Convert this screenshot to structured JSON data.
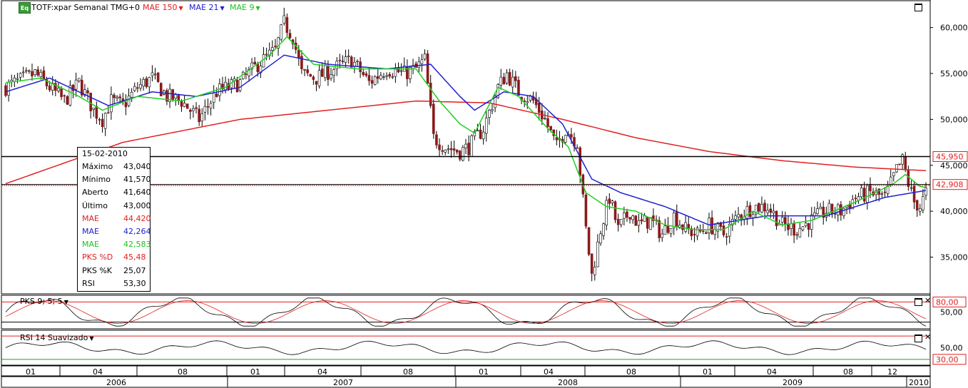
{
  "header": {
    "logo_text": "Eq",
    "title": "TOTF:xpar Semanal TMG+0",
    "indicators": [
      {
        "label": "MAE 150",
        "color": "#e02020"
      },
      {
        "label": "MAE 21",
        "color": "#2020d0"
      },
      {
        "label": "MAE 9",
        "color": "#20d020"
      }
    ]
  },
  "info_box": {
    "date": "15-02-2010",
    "rows": [
      {
        "label": "Máximo",
        "value": "43,040",
        "color": "#000000"
      },
      {
        "label": "Mínimo",
        "value": "41,570",
        "color": "#000000"
      },
      {
        "label": "Aberto",
        "value": "41,640",
        "color": "#000000"
      },
      {
        "label": "Último",
        "value": "43,000",
        "color": "#000000"
      },
      {
        "label": "MAE",
        "value": "44,420",
        "color": "#e02020"
      },
      {
        "label": "MAE",
        "value": "42,264",
        "color": "#2020d0"
      },
      {
        "label": "MAE",
        "value": "42,583",
        "color": "#20c020"
      },
      {
        "label": "PKS %D",
        "value": "45,48",
        "color": "#e02020"
      },
      {
        "label": "PKS %K",
        "value": "25,07",
        "color": "#000000"
      },
      {
        "label": "RSI",
        "value": "53,30",
        "color": "#000000"
      }
    ]
  },
  "panes": {
    "pks_label": "PKS 9; 5; 5",
    "rsi_label": "RSI 14 Suavizado"
  },
  "chart_data": [
    {
      "type": "candlestick",
      "ylim": [
        31000,
        63000
      ],
      "y_ticks": [
        "60,000",
        "55,000",
        "50,000",
        "45,000",
        "40,000",
        "35,000"
      ],
      "y_tick_values": [
        60000,
        55000,
        50000,
        45000,
        40000,
        35000
      ],
      "horizontal_lines": [
        {
          "value": 45950,
          "label": "45,950"
        },
        {
          "value": 42908,
          "label": "42,908"
        }
      ],
      "x_ticks": [
        "01",
        "04",
        "08",
        "01",
        "04",
        "08",
        "01",
        "04",
        "08",
        "01",
        "04",
        "08",
        "12"
      ],
      "x_years": [
        "2006",
        "2007",
        "2008",
        "2009",
        "2010"
      ],
      "price_path": [
        [
          0,
          53500
        ],
        [
          10,
          55000
        ],
        [
          20,
          52000
        ],
        [
          25,
          54000
        ],
        [
          30,
          51000
        ],
        [
          33,
          50000
        ],
        [
          36,
          52000
        ],
        [
          40,
          51500
        ],
        [
          45,
          53500
        ],
        [
          50,
          54500
        ],
        [
          55,
          52500
        ],
        [
          60,
          52000
        ],
        [
          63,
          51000
        ],
        [
          66,
          50000
        ],
        [
          72,
          53000
        ],
        [
          80,
          54000
        ],
        [
          86,
          56000
        ],
        [
          92,
          57500
        ],
        [
          95,
          60500
        ],
        [
          98,
          59000
        ],
        [
          101,
          55000
        ],
        [
          106,
          54500
        ],
        [
          112,
          55500
        ],
        [
          118,
          56500
        ],
        [
          124,
          54000
        ],
        [
          130,
          55500
        ],
        [
          136,
          55000
        ],
        [
          140,
          55500
        ],
        [
          143,
          56500
        ],
        [
          146,
          48000
        ],
        [
          150,
          47000
        ],
        [
          155,
          46500
        ],
        [
          158,
          47000
        ],
        [
          163,
          49000
        ],
        [
          168,
          53500
        ],
        [
          171,
          55000
        ],
        [
          175,
          53000
        ],
        [
          180,
          52000
        ],
        [
          184,
          50000
        ],
        [
          188,
          47000
        ],
        [
          191,
          49000
        ],
        [
          195,
          47500
        ],
        [
          198,
          38000
        ],
        [
          200,
          33000
        ],
        [
          203,
          38000
        ],
        [
          206,
          41500
        ],
        [
          209,
          38000
        ],
        [
          213,
          40000
        ],
        [
          216,
          38500
        ],
        [
          220,
          39000
        ],
        [
          224,
          37500
        ],
        [
          228,
          39500
        ],
        [
          232,
          38000
        ],
        [
          236,
          37500
        ],
        [
          240,
          38500
        ],
        [
          245,
          37500
        ],
        [
          250,
          39500
        ],
        [
          255,
          40500
        ],
        [
          260,
          40500
        ],
        [
          265,
          38500
        ],
        [
          270,
          38000
        ],
        [
          275,
          39000
        ],
        [
          280,
          40000
        ],
        [
          285,
          40000
        ],
        [
          290,
          41500
        ],
        [
          295,
          42000
        ],
        [
          300,
          41500
        ],
        [
          304,
          44500
        ],
        [
          306,
          45500
        ],
        [
          308,
          43000
        ],
        [
          310,
          41000
        ],
        [
          312,
          40500
        ],
        [
          314,
          42000
        ]
      ],
      "mae150_path": [
        [
          0,
          43000
        ],
        [
          40,
          47500
        ],
        [
          80,
          50000
        ],
        [
          110,
          51000
        ],
        [
          140,
          52000
        ],
        [
          165,
          51800
        ],
        [
          190,
          50000
        ],
        [
          215,
          48000
        ],
        [
          240,
          46500
        ],
        [
          265,
          45500
        ],
        [
          290,
          44800
        ],
        [
          314,
          44420
        ]
      ],
      "mae21_path": [
        [
          0,
          53000
        ],
        [
          15,
          54500
        ],
        [
          25,
          53000
        ],
        [
          35,
          51500
        ],
        [
          50,
          53000
        ],
        [
          65,
          52500
        ],
        [
          80,
          53500
        ],
        [
          95,
          57000
        ],
        [
          110,
          56000
        ],
        [
          130,
          55500
        ],
        [
          145,
          56000
        ],
        [
          155,
          52500
        ],
        [
          160,
          51000
        ],
        [
          170,
          53000
        ],
        [
          180,
          52500
        ],
        [
          190,
          49500
        ],
        [
          200,
          43500
        ],
        [
          210,
          42000
        ],
        [
          225,
          40500
        ],
        [
          240,
          38500
        ],
        [
          260,
          39500
        ],
        [
          280,
          39500
        ],
        [
          300,
          41500
        ],
        [
          314,
          42264
        ]
      ],
      "mae9_path": [
        [
          0,
          54000
        ],
        [
          12,
          54500
        ],
        [
          25,
          52500
        ],
        [
          33,
          51000
        ],
        [
          45,
          52500
        ],
        [
          60,
          52000
        ],
        [
          75,
          53500
        ],
        [
          90,
          57000
        ],
        [
          96,
          59000
        ],
        [
          105,
          56000
        ],
        [
          120,
          55500
        ],
        [
          140,
          55500
        ],
        [
          148,
          52000
        ],
        [
          155,
          49500
        ],
        [
          160,
          48500
        ],
        [
          168,
          53500
        ],
        [
          175,
          52500
        ],
        [
          185,
          49000
        ],
        [
          192,
          47000
        ],
        [
          198,
          42000
        ],
        [
          205,
          40500
        ],
        [
          215,
          40000
        ],
        [
          225,
          38500
        ],
        [
          235,
          38000
        ],
        [
          245,
          38000
        ],
        [
          255,
          40000
        ],
        [
          265,
          38500
        ],
        [
          275,
          39000
        ],
        [
          290,
          41000
        ],
        [
          303,
          43000
        ],
        [
          307,
          44000
        ],
        [
          312,
          42700
        ],
        [
          314,
          42583
        ]
      ]
    },
    {
      "type": "line",
      "name": "PKS 9; 5; 5",
      "ylim": [
        0,
        100
      ],
      "y_ticks": [
        "80,00",
        "50,00"
      ],
      "y_tick_values": [
        80,
        50
      ],
      "series": [
        {
          "name": "%K",
          "color": "#000000"
        },
        {
          "name": "%D",
          "color": "#e02020"
        }
      ],
      "last_k": 25.07,
      "last_d": 45.48
    },
    {
      "type": "line",
      "name": "RSI 14 Suavizado",
      "ylim": [
        20,
        80
      ],
      "y_ticks": [
        "50,00",
        "30,00"
      ],
      "y_tick_values": [
        50,
        30
      ],
      "series": [
        {
          "name": "RSI",
          "color": "#000000"
        }
      ],
      "last_value": 53.3
    }
  ]
}
